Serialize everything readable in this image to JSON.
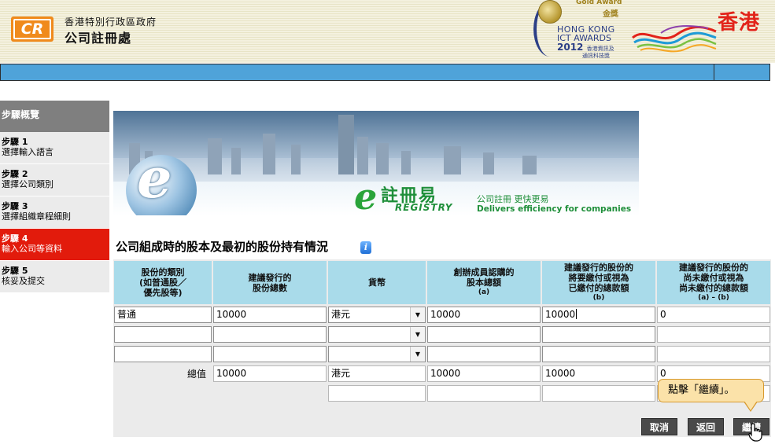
{
  "header": {
    "logo_text": "CR",
    "org_line1": "香港特別行政區政府",
    "org_line2": "公司註冊處",
    "award": {
      "gold_award": "Gold Award",
      "gold_cn": "金獎",
      "line1": "HONG KONG",
      "line2": "ICT AWARDS",
      "year": "2012",
      "year_cn": "香港資訊及",
      "line4": "通訊科技獎"
    },
    "brand_text": "香港"
  },
  "sidebar": {
    "title": "步驟概覽",
    "items": [
      {
        "step": "步驟 1",
        "label": "選擇輸入語言",
        "active": false
      },
      {
        "step": "步驟 2",
        "label": "選擇公司類別",
        "active": false
      },
      {
        "step": "步驟 3",
        "label": "選擇組織章程細則",
        "active": false
      },
      {
        "step": "步驟 4",
        "label": "輸入公司等資料",
        "active": true
      },
      {
        "step": "步驟 5",
        "label": "核妥及提交",
        "active": false
      }
    ]
  },
  "banner": {
    "cn": "註冊易",
    "en": "REGISTRY",
    "tag_cn": "公司註冊 更快更易",
    "tag_en": "Delivers efficiency for companies"
  },
  "section_title": "公司組成時的股本及最初的股份持有情況",
  "table": {
    "headers": [
      {
        "l1": "股份的類別",
        "l2": "(如普通股／",
        "l3": "優先股等)",
        "sub": ""
      },
      {
        "l1": "建議發行的",
        "l2": "股份總數",
        "l3": "",
        "sub": ""
      },
      {
        "l1": "貨幣",
        "l2": "",
        "l3": "",
        "sub": ""
      },
      {
        "l1": "創辦成員認購的",
        "l2": "股本總額",
        "l3": "",
        "sub": "(a)"
      },
      {
        "l1": "建議發行的股份的",
        "l2": "將要繳付或視為",
        "l3": "已繳付的總款額",
        "sub": "(b)"
      },
      {
        "l1": "建議發行的股份的",
        "l2": "尚未繳付或視為",
        "l3": "尚未繳付的總款額",
        "sub": "(a) – (b)"
      }
    ],
    "rows": [
      {
        "class": "普通",
        "shares": "10000",
        "currency": "港元",
        "total_a": "10000",
        "paid_b": "10000",
        "unpaid": "0"
      },
      {
        "class": "",
        "shares": "",
        "currency": "",
        "total_a": "",
        "paid_b": "",
        "unpaid": ""
      },
      {
        "class": "",
        "shares": "",
        "currency": "",
        "total_a": "",
        "paid_b": "",
        "unpaid": ""
      }
    ],
    "total": {
      "label": "總值",
      "shares": "10000",
      "currency": "港元",
      "total_a": "10000",
      "paid_b": "10000",
      "unpaid": "0"
    },
    "extra_row": {
      "currency": "",
      "total_a": "",
      "paid_b": "",
      "unpaid": ""
    }
  },
  "buttons": {
    "cancel": "取消",
    "back": "返回",
    "continue": "繼續"
  },
  "tooltip": "點擊「繼續」。",
  "colors": {
    "accent_blue": "#4fa3d9",
    "header_cell": "#a9dbea",
    "active_step": "#e21b0c",
    "logo_orange": "#f08a1c"
  }
}
